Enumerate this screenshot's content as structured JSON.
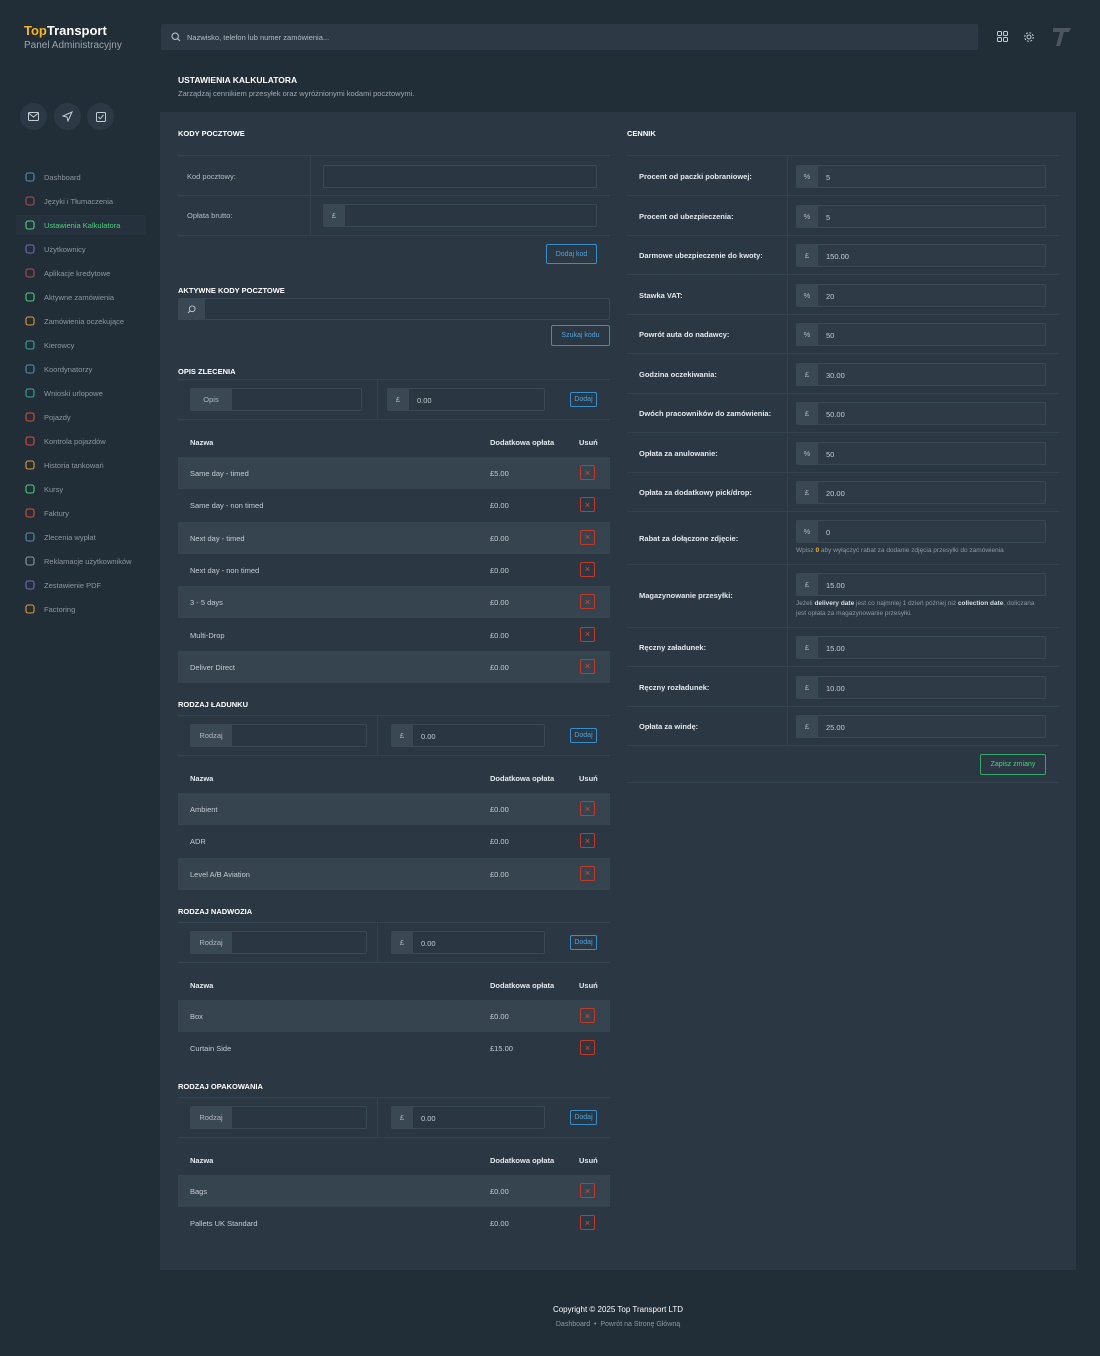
{
  "brand": {
    "top": "Top",
    "transport": "Transport",
    "subtitle": "Panel Administracyjny"
  },
  "search": {
    "placeholder": "Nazwisko, telefon lub numer zamówienia..."
  },
  "page": {
    "title": "USTAWIENIA KALKULATORA",
    "subtitle": "Zarządzaj cennikiem przesyłek oraz wyróżnionymi kodami pocztowymi."
  },
  "sidebar": {
    "items": [
      {
        "label": "Dashboard",
        "icon": "home-icon"
      },
      {
        "label": "Języki i Tłumaczenia",
        "icon": "translate-icon"
      },
      {
        "label": "Ustawienia Kalkulatora",
        "icon": "calculator-icon",
        "active": true
      },
      {
        "label": "Użytkownicy",
        "icon": "users-icon"
      },
      {
        "label": "Aplikacje kredytowe",
        "icon": "credit-icon"
      },
      {
        "label": "Aktywne zamówienia",
        "icon": "check-square-icon"
      },
      {
        "label": "Zamówienia oczekujące",
        "icon": "clock-icon"
      },
      {
        "label": "Kierowcy",
        "icon": "steering-icon"
      },
      {
        "label": "Koordynatorzy",
        "icon": "coordinator-icon"
      },
      {
        "label": "Wnioski urlopowe",
        "icon": "sun-icon"
      },
      {
        "label": "Pojazdy",
        "icon": "truck-icon"
      },
      {
        "label": "Kontrola pojazdów",
        "icon": "truck-check-icon"
      },
      {
        "label": "Historia tankowań",
        "icon": "fuel-truck-icon"
      },
      {
        "label": "Kursy",
        "icon": "flag-icon"
      },
      {
        "label": "Faktury",
        "icon": "invoice-icon"
      },
      {
        "label": "Zlecenia wypłat",
        "icon": "payout-icon"
      },
      {
        "label": "Reklamacje użytkowników",
        "icon": "warning-icon"
      },
      {
        "label": "Zestawienie PDF",
        "icon": "pdf-icon"
      },
      {
        "label": "Factoring",
        "icon": "factoring-icon"
      }
    ]
  },
  "postal": {
    "title": "KODY POCZTOWE",
    "code_label": "Kod pocztowy:",
    "fee_label": "Opłata brutto:",
    "currency": "£",
    "add_button": "Dodaj kod",
    "active_title": "AKTYWNE KODY POCZTOWE",
    "search_button": "Szukaj kodu"
  },
  "columns": {
    "name": "Nazwa",
    "extra": "Dodatkowa opłata",
    "remove": "Usuń",
    "remove_symbol": "×"
  },
  "order_desc": {
    "title": "OPIS ZLECENIA",
    "placeholder": "Opis",
    "amount": "0.00",
    "add": "Dodaj",
    "rows": [
      {
        "name": "Same day - timed",
        "price": "£5.00"
      },
      {
        "name": "Same day - non timed",
        "price": "£0.00"
      },
      {
        "name": "Next day - timed",
        "price": "£0.00"
      },
      {
        "name": "Next day - non timed",
        "price": "£0.00"
      },
      {
        "name": "3 - 5 days",
        "price": "£0.00"
      },
      {
        "name": "Multi-Drop",
        "price": "£0.00"
      },
      {
        "name": "Deliver Direct",
        "price": "£0.00"
      }
    ]
  },
  "cargo": {
    "title": "RODZAJ ŁADUNKU",
    "placeholder": "Rodzaj",
    "amount": "0.00",
    "add": "Dodaj",
    "rows": [
      {
        "name": "Ambient",
        "price": "£0.00"
      },
      {
        "name": "ADR",
        "price": "£0.00"
      },
      {
        "name": "Level A/B Aviation",
        "price": "£0.00"
      }
    ]
  },
  "body": {
    "title": "RODZAJ NADWOZIA",
    "placeholder": "Rodzaj",
    "amount": "0.00",
    "add": "Dodaj",
    "rows": [
      {
        "name": "Box",
        "price": "£0.00"
      },
      {
        "name": "Curtain Side",
        "price": "£15.00"
      }
    ]
  },
  "packaging": {
    "title": "RODZAJ OPAKOWANIA",
    "placeholder": "Rodzaj",
    "amount": "0.00",
    "add": "Dodaj",
    "rows": [
      {
        "name": "Bags",
        "price": "£0.00"
      },
      {
        "name": "Pallets UK Standard",
        "price": "£0.00"
      }
    ]
  },
  "pricing": {
    "title": "CENNIK",
    "save": "Zapisz zmiany",
    "fields": [
      {
        "label": "Procent od paczki pobraniowej:",
        "unit": "%",
        "value": "5"
      },
      {
        "label": "Procent od ubezpieczenia:",
        "unit": "%",
        "value": "5"
      },
      {
        "label": "Darmowe ubezpieczenie do kwoty:",
        "unit": "£",
        "value": "150.00"
      },
      {
        "label": "Stawka VAT:",
        "unit": "%",
        "value": "20"
      },
      {
        "label": "Powrót auta do nadawcy:",
        "unit": "%",
        "value": "50"
      },
      {
        "label": "Godzina oczekiwania:",
        "unit": "£",
        "value": "30.00"
      },
      {
        "label": "Dwóch pracowników do zamówienia:",
        "unit": "£",
        "value": "50.00"
      },
      {
        "label": "Opłata za anulowanie:",
        "unit": "%",
        "value": "50"
      },
      {
        "label": "Opłata za dodatkowy pick/drop:",
        "unit": "£",
        "value": "20.00"
      },
      {
        "label": "Rabat za dołączone zdjęcie:",
        "unit": "%",
        "value": "0"
      },
      {
        "label": "Magazynowanie przesyłki:",
        "unit": "£",
        "value": "15.00"
      },
      {
        "label": "Ręczny załadunek:",
        "unit": "£",
        "value": "15.00"
      },
      {
        "label": "Ręczny rozładunek:",
        "unit": "£",
        "value": "10.00"
      },
      {
        "label": "Opłata za windę:",
        "unit": "£",
        "value": "25.00"
      }
    ],
    "help_photo": {
      "pre": "Wpisz ",
      "zero": "0",
      "post": " aby wyłączyć rabat za dodanie zdjęcia przesyłki do zamówienia"
    },
    "help_storage": {
      "a": "Jeżeli ",
      "b": "delivery date",
      "c": " jest co najmniej 1 dzień później niż ",
      "d": "collection date",
      "e": ", doliczana",
      "f": "jest opłata za magazynowanie przesyłki."
    }
  },
  "footer": {
    "copyright": "Copyright © 2025 Top Transport LTD",
    "link_dashboard": "Dashboard",
    "sep": "•",
    "link_home": "Powrót na Stronę Główną"
  },
  "colors": {
    "background": "#212d37",
    "panel": "#2b3844",
    "accent_green": "#4ecf7d",
    "accent_blue": "#4aa3df",
    "danger": "#e04a3a",
    "brand_yellow": "#f3b52a"
  }
}
